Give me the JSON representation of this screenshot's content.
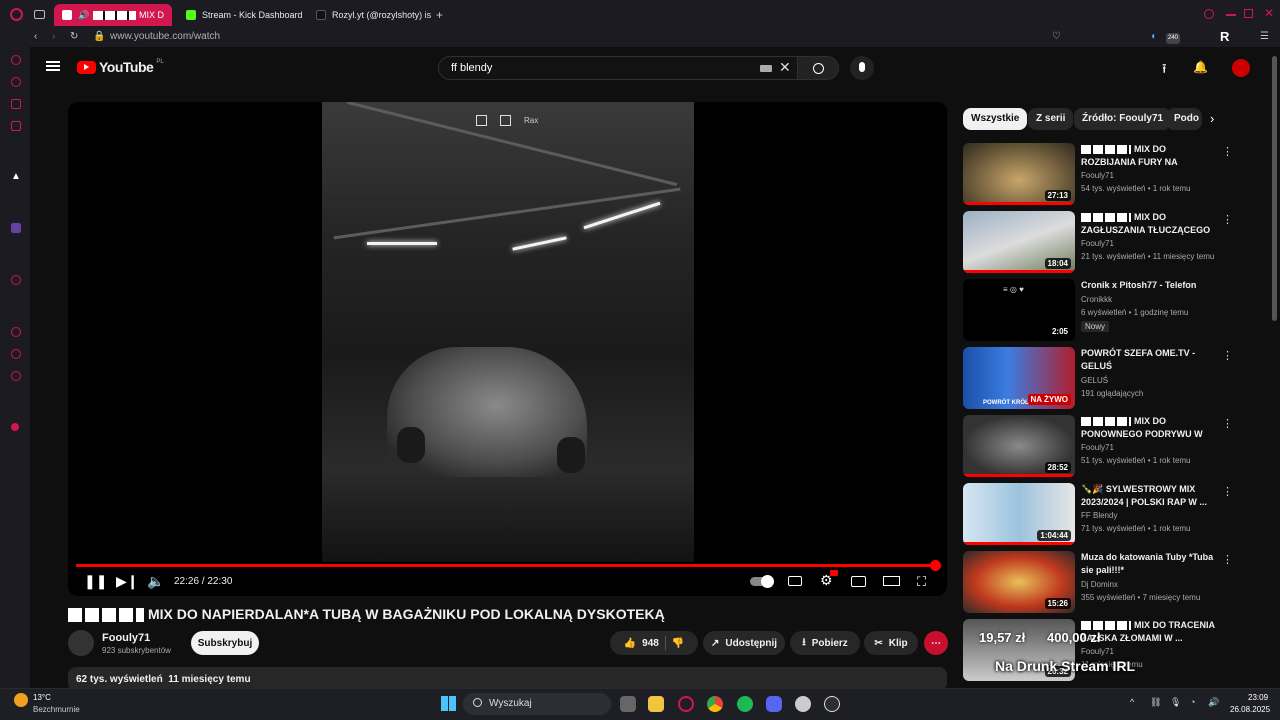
{
  "browser": {
    "tabs": [
      {
        "label": "MIX D"
      },
      {
        "label": "Stream - Kick Dashboard"
      },
      {
        "label": "Rozyl.yt (@rozylshoty) is"
      }
    ],
    "url": "www.youtube.com/watch"
  },
  "youtube": {
    "logo_text": "YouTube",
    "logo_region": "PL",
    "search_value": "ff blendy"
  },
  "player": {
    "time": "22:26 / 22:30",
    "progress": 0.997,
    "overlay_label": "Rax"
  },
  "video": {
    "title": "MIX DO NAPIERDALAN*A TUBĄ W BAGAŻNIKU POD LOKALNĄ DYSKOTEKĄ",
    "channel": "Foouly71",
    "subscribers": "923 subskrybentów",
    "subscribe_label": "Subskrybuj",
    "likes": "948",
    "share_label": "Udostępnij",
    "download_label": "Pobierz",
    "clip_label": "Klip",
    "views": "62 tys. wyświetleń",
    "age": "11 miesięcy temu"
  },
  "filters": [
    "Wszystkie",
    "Z serii",
    "Źródło: Foouly71",
    "Podo"
  ],
  "recommendations": [
    {
      "title_a": "MIX DO",
      "title_b": "ROZBIJANIA FURY NA RONDZ...",
      "channel": "Foouly71",
      "meta": "54 tys. wyświetleń • 1 rok temu",
      "duration": "27:13"
    },
    {
      "title_a": "MIX DO",
      "title_b": "ZAGŁUSZANIA TŁUCZĄCEGO ...",
      "channel": "Foouly71",
      "meta": "21 tys. wyświetleń • 11 miesięcy temu",
      "duration": "18:04"
    },
    {
      "title_a": "",
      "title_b": "Cronik x Pitosh77 - Telefon",
      "channel": "Cronikkk",
      "meta": "6 wyświetleń • 1 godzinę temu",
      "duration": "2:05",
      "badge": "Nowy"
    },
    {
      "title_a": "",
      "title_b": "POWRÓT SZEFA OME.TV - GELUŚ",
      "channel": "GELUŚ",
      "meta": "191 oglądających",
      "duration": "",
      "live": "NA ŻYWO",
      "thumb_text": "POWRÓT KRÓL"
    },
    {
      "title_a": "MIX DO",
      "title_b": "PONOWNEGO PODRYWU W E...",
      "channel": "Foouly71",
      "meta": "51 tys. wyświetleń • 1 rok temu",
      "duration": "28:52"
    },
    {
      "title_a": "",
      "title_b": "🍾🎉 SYLWESTROWY MIX 2023/2024 | POLSKI RAP W ...",
      "channel": "FF Blendy",
      "meta": "71 tys. wyświetleń • 1 rok temu",
      "duration": "1:04:44"
    },
    {
      "title_a": "",
      "title_b": "Muza do katowania Tuby *Tuba sie pali!!!*",
      "channel": "Dj Dominx",
      "meta": "355 wyświetleń • 7 miesięcy temu",
      "duration": "15:26"
    },
    {
      "title_a": "MIX DO TRACENIA",
      "title_b": "ŻALSKA ZŁOMAMI W ...",
      "channel": "Foouly71",
      "meta": "11 miesięcy temu",
      "duration": "26:32"
    }
  ],
  "stream_overlay": {
    "donation": "19,57 zł",
    "amount": "400,00 zł",
    "caption": "Na Drunk Stream IRL"
  },
  "taskbar": {
    "temp": "13°C",
    "weather": "Bezchmurnie",
    "search_label": "Wyszukaj",
    "time": "23:09",
    "date": "26.08.2025"
  },
  "colors": {
    "accent": "#ff0000",
    "opera": "#d2164e",
    "bg": "#0f0f0f"
  }
}
